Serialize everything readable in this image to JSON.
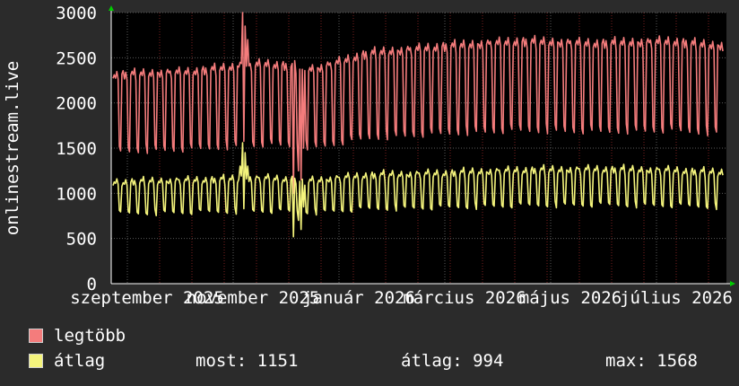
{
  "chart_data": {
    "type": "line",
    "ylabel": "onlinestream.live",
    "ylim": [
      0,
      3000
    ],
    "yticks": [
      0,
      500,
      1000,
      1500,
      2000,
      2500,
      3000
    ],
    "xlabels": [
      "szeptember 2025",
      "november 2025",
      "január 2026",
      "március 2026",
      "május 2026",
      "július 2026"
    ],
    "grid": true,
    "colors": {
      "background": "#2b2b2b",
      "plot": "#000000",
      "grid": "#5a5a5a",
      "minor_grid": "#7a2020",
      "max_series": "#f47c7c",
      "avg_series": "#f4f47c",
      "axis_arrow": "#00cc00"
    },
    "series": [
      {
        "name": "legtöbb",
        "color": "#f47c7c",
        "week_pattern": [
          2050,
          2080,
          2040,
          2100,
          2020,
          1350,
          1300
        ],
        "trend": [
          [
            0,
            2070
          ],
          [
            60,
            2100
          ],
          [
            120,
            2180
          ],
          [
            160,
            2130
          ],
          [
            200,
            2280
          ],
          [
            260,
            2350
          ],
          [
            320,
            2400
          ],
          [
            380,
            2380
          ],
          [
            440,
            2400
          ],
          [
            470,
            2360
          ]
        ],
        "spikes": [
          [
            100,
            2450
          ],
          [
            102,
            3000
          ],
          [
            104,
            2850
          ],
          [
            106,
            2700
          ],
          [
            142,
            1000
          ],
          [
            146,
            1250
          ],
          [
            148,
            1150
          ],
          [
            150,
            1500
          ]
        ]
      },
      {
        "name": "átlag",
        "color": "#f4f47c",
        "week_pattern": [
          1000,
          1030,
          1010,
          1050,
          990,
          720,
          700
        ],
        "trend": [
          [
            0,
            1020
          ],
          [
            60,
            1040
          ],
          [
            120,
            1060
          ],
          [
            160,
            1040
          ],
          [
            200,
            1090
          ],
          [
            260,
            1110
          ],
          [
            320,
            1140
          ],
          [
            380,
            1150
          ],
          [
            440,
            1140
          ],
          [
            470,
            1120
          ]
        ],
        "spikes": [
          [
            100,
            1300
          ],
          [
            102,
            1560
          ],
          [
            104,
            1450
          ],
          [
            106,
            1300
          ],
          [
            142,
            520
          ],
          [
            146,
            700
          ],
          [
            148,
            600
          ],
          [
            150,
            850
          ]
        ]
      }
    ]
  },
  "legend": {
    "max_label": "legtöbb",
    "avg_label": "átlag",
    "now": "most: 1151",
    "avg": "átlag: 994",
    "max": "max: 1568"
  }
}
